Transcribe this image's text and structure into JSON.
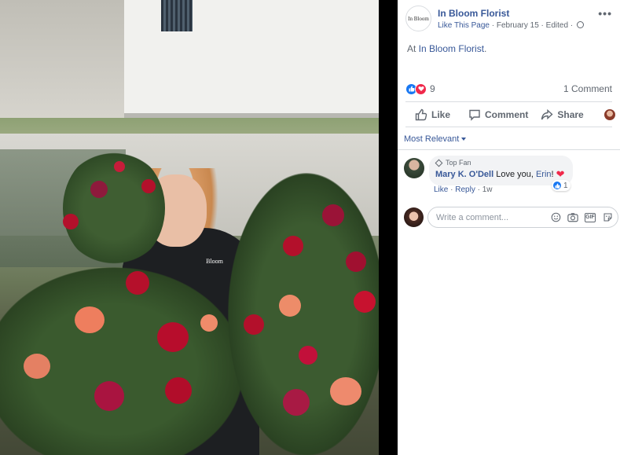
{
  "post": {
    "page_name": "In Bloom Florist",
    "avatar_text": "In Bloom",
    "meta": {
      "like_link": "Like This Page",
      "separator": " · ",
      "date": "February 15",
      "edited": "Edited",
      "privacy_icon": "globe-icon"
    },
    "text_prefix": "At ",
    "location_link": "In Bloom Florist",
    "text_suffix": ".",
    "reaction_icons": [
      "like-reaction-icon",
      "love-reaction-icon"
    ],
    "reaction_count": "9",
    "comment_count": "1 Comment",
    "shirt_logo_text": "Bloom"
  },
  "actions": {
    "like": "Like",
    "comment": "Comment",
    "share": "Share"
  },
  "comments": {
    "sort_label": "Most Relevant",
    "items": [
      {
        "badge": "Top Fan",
        "author": "Mary K. O'Dell",
        "text": "Love you, ",
        "tag": "Erin",
        "text_end": "!",
        "emoji": "heart",
        "reaction_count": "1",
        "like_link": "Like",
        "reply_link": "Reply",
        "age": "1w"
      }
    ]
  },
  "compose": {
    "placeholder": "Write a comment...",
    "icons": [
      "emoji-icon",
      "camera-icon",
      "gif-icon",
      "sticker-icon"
    ],
    "gif_label": "GIF"
  },
  "colors": {
    "link": "#385898",
    "secondary_text": "#606770",
    "like_blue": "#1877f2",
    "love_red": "#f0284a"
  }
}
